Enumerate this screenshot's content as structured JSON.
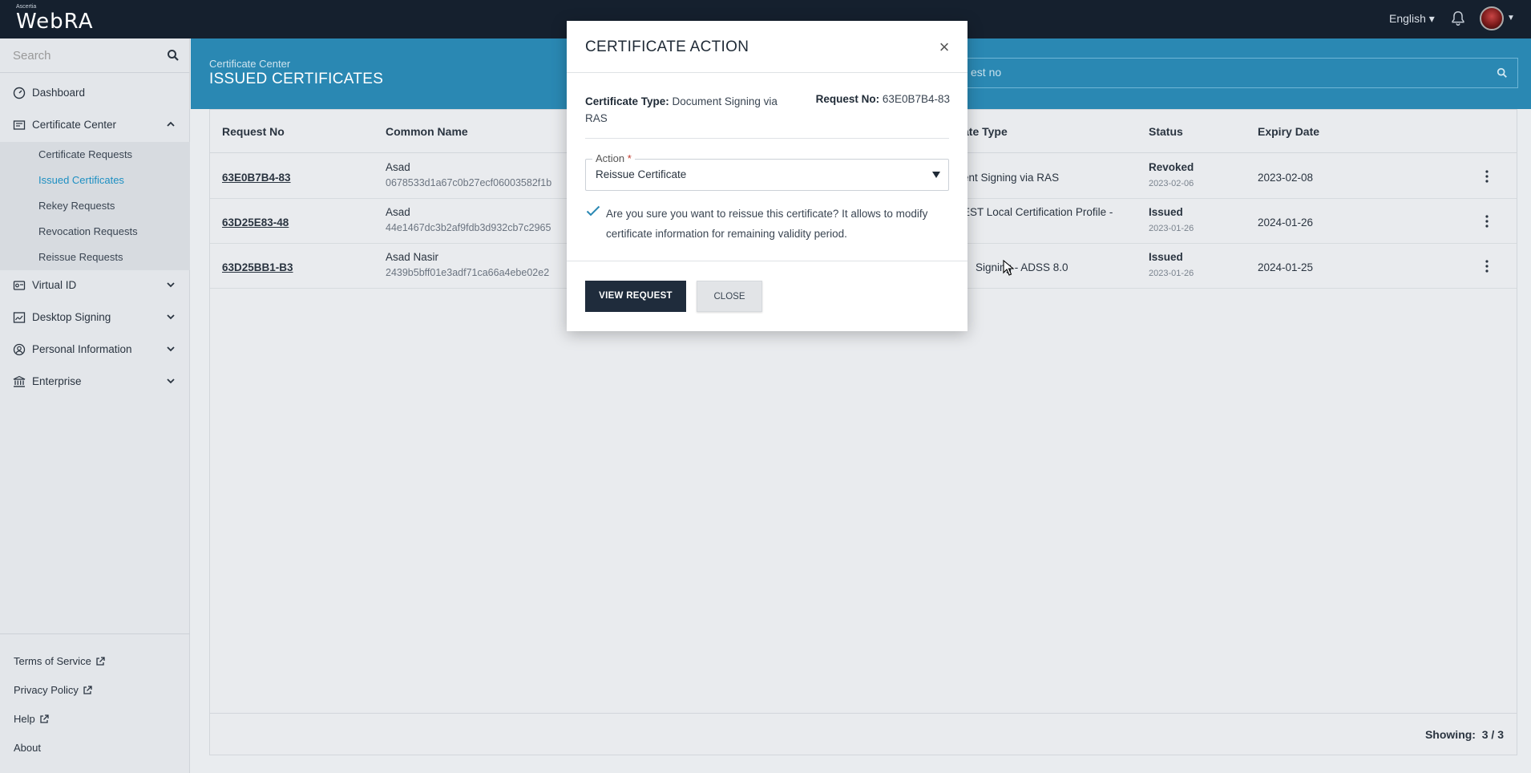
{
  "topbar": {
    "logo_small": "Ascertia",
    "logo_big": "WebRA",
    "language": "English ▾"
  },
  "sidebar": {
    "search_placeholder": "Search",
    "items": [
      {
        "label": "Dashboard",
        "icon": "dashboard-icon"
      },
      {
        "label": "Certificate Center",
        "icon": "certificate-icon",
        "expanded": true
      },
      {
        "label": "Virtual ID",
        "icon": "id-card-icon"
      },
      {
        "label": "Desktop Signing",
        "icon": "signature-icon"
      },
      {
        "label": "Personal Information",
        "icon": "user-circle-icon"
      },
      {
        "label": "Enterprise",
        "icon": "bank-icon"
      }
    ],
    "sub_items": [
      {
        "label": "Certificate Requests"
      },
      {
        "label": "Issued Certificates",
        "active": true
      },
      {
        "label": "Rekey Requests"
      },
      {
        "label": "Revocation Requests"
      },
      {
        "label": "Reissue Requests"
      }
    ],
    "footer": {
      "terms": "Terms of Service",
      "privacy": "Privacy Policy",
      "help": "Help",
      "about": "About"
    }
  },
  "header": {
    "breadcrumb": "Certificate Center",
    "title": "ISSUED CERTIFICATES",
    "search_placeholder": "est no"
  },
  "table": {
    "columns": [
      "Request No",
      "Common Name",
      "ate Type",
      "Status",
      "Expiry Date"
    ],
    "rows": [
      {
        "request_no": "63E0B7B4-83",
        "common_name": "Asad",
        "hash": "0678533d1a67c0b27ecf06003582f1b",
        "cert_type": "ent Signing via RAS",
        "status": "Revoked",
        "status_date": "2023-02-06",
        "expiry": "2023-02-08"
      },
      {
        "request_no": "63D25E83-48",
        "common_name": "Asad",
        "hash": "44e1467dc3b2af9fdb3d932cb7c2965",
        "cert_type": "EST Local Certification Profile -",
        "status": "Issued",
        "status_date": "2023-01-26",
        "expiry": "2024-01-26"
      },
      {
        "request_no": "63D25BB1-B3",
        "common_name": "Asad Nasir",
        "hash": "2439b5bff01e3adf71ca66a4ebe02e2",
        "cert_type": "Signing - ADSS 8.0",
        "status": "Issued",
        "status_date": "2023-01-26",
        "expiry": "2024-01-25"
      }
    ],
    "showing_label": "Showing:",
    "showing_value": "3 / 3"
  },
  "modal": {
    "title": "CERTIFICATE ACTION",
    "cert_type_label": "Certificate Type:",
    "cert_type_value": "Document Signing via RAS",
    "request_no_label": "Request No:",
    "request_no_value": "63E0B7B4-83",
    "action_label": "Action",
    "action_required": "*",
    "action_value": "Reissue Certificate",
    "confirm_text": "Are you sure you want to reissue this certificate? It allows to modify certificate information for remaining validity period.",
    "view_button": "VIEW REQUEST",
    "close_button": "CLOSE"
  },
  "colors": {
    "topbar": "#15202e",
    "header": "#2a88b3",
    "active_link": "#1d8fc2",
    "primary_button": "#1f2c3c"
  }
}
